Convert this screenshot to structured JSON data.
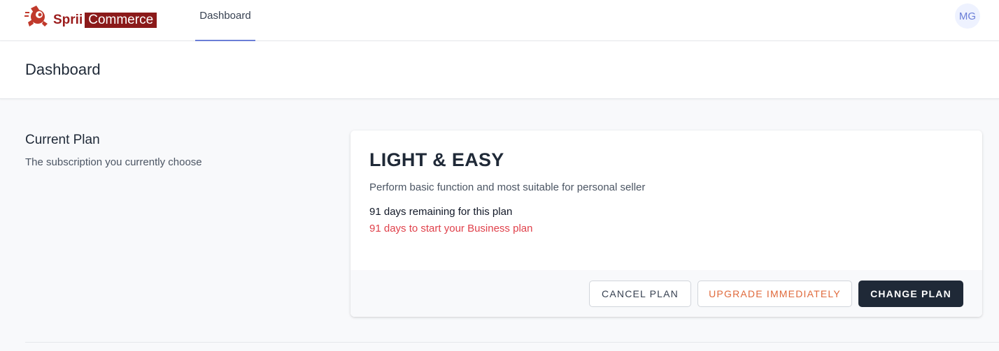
{
  "brand": {
    "name_part1": "Sprii",
    "name_part2": "Commerce",
    "color": "#9b1c1c"
  },
  "nav": {
    "tabs": [
      {
        "label": "Dashboard",
        "active": true
      }
    ]
  },
  "user": {
    "initials": "MG"
  },
  "page": {
    "title": "Dashboard"
  },
  "current_plan": {
    "section_title": "Current Plan",
    "section_desc": "The subscription you currently choose",
    "plan_name": "LIGHT & EASY",
    "plan_desc": "Perform basic function and most suitable for personal seller",
    "remaining": "91 days remaining for this plan",
    "business_notice": "91 days to start your Business plan"
  },
  "actions": {
    "cancel_label": "CANCEL PLAN",
    "upgrade_label": "UPGRADE IMMEDIATELY",
    "change_label": "CHANGE PLAN"
  },
  "colors": {
    "accent": "#6b7fd7",
    "warning_text": "#e0414b",
    "upgrade_text": "#e06a3c",
    "primary_button": "#1f2937"
  }
}
